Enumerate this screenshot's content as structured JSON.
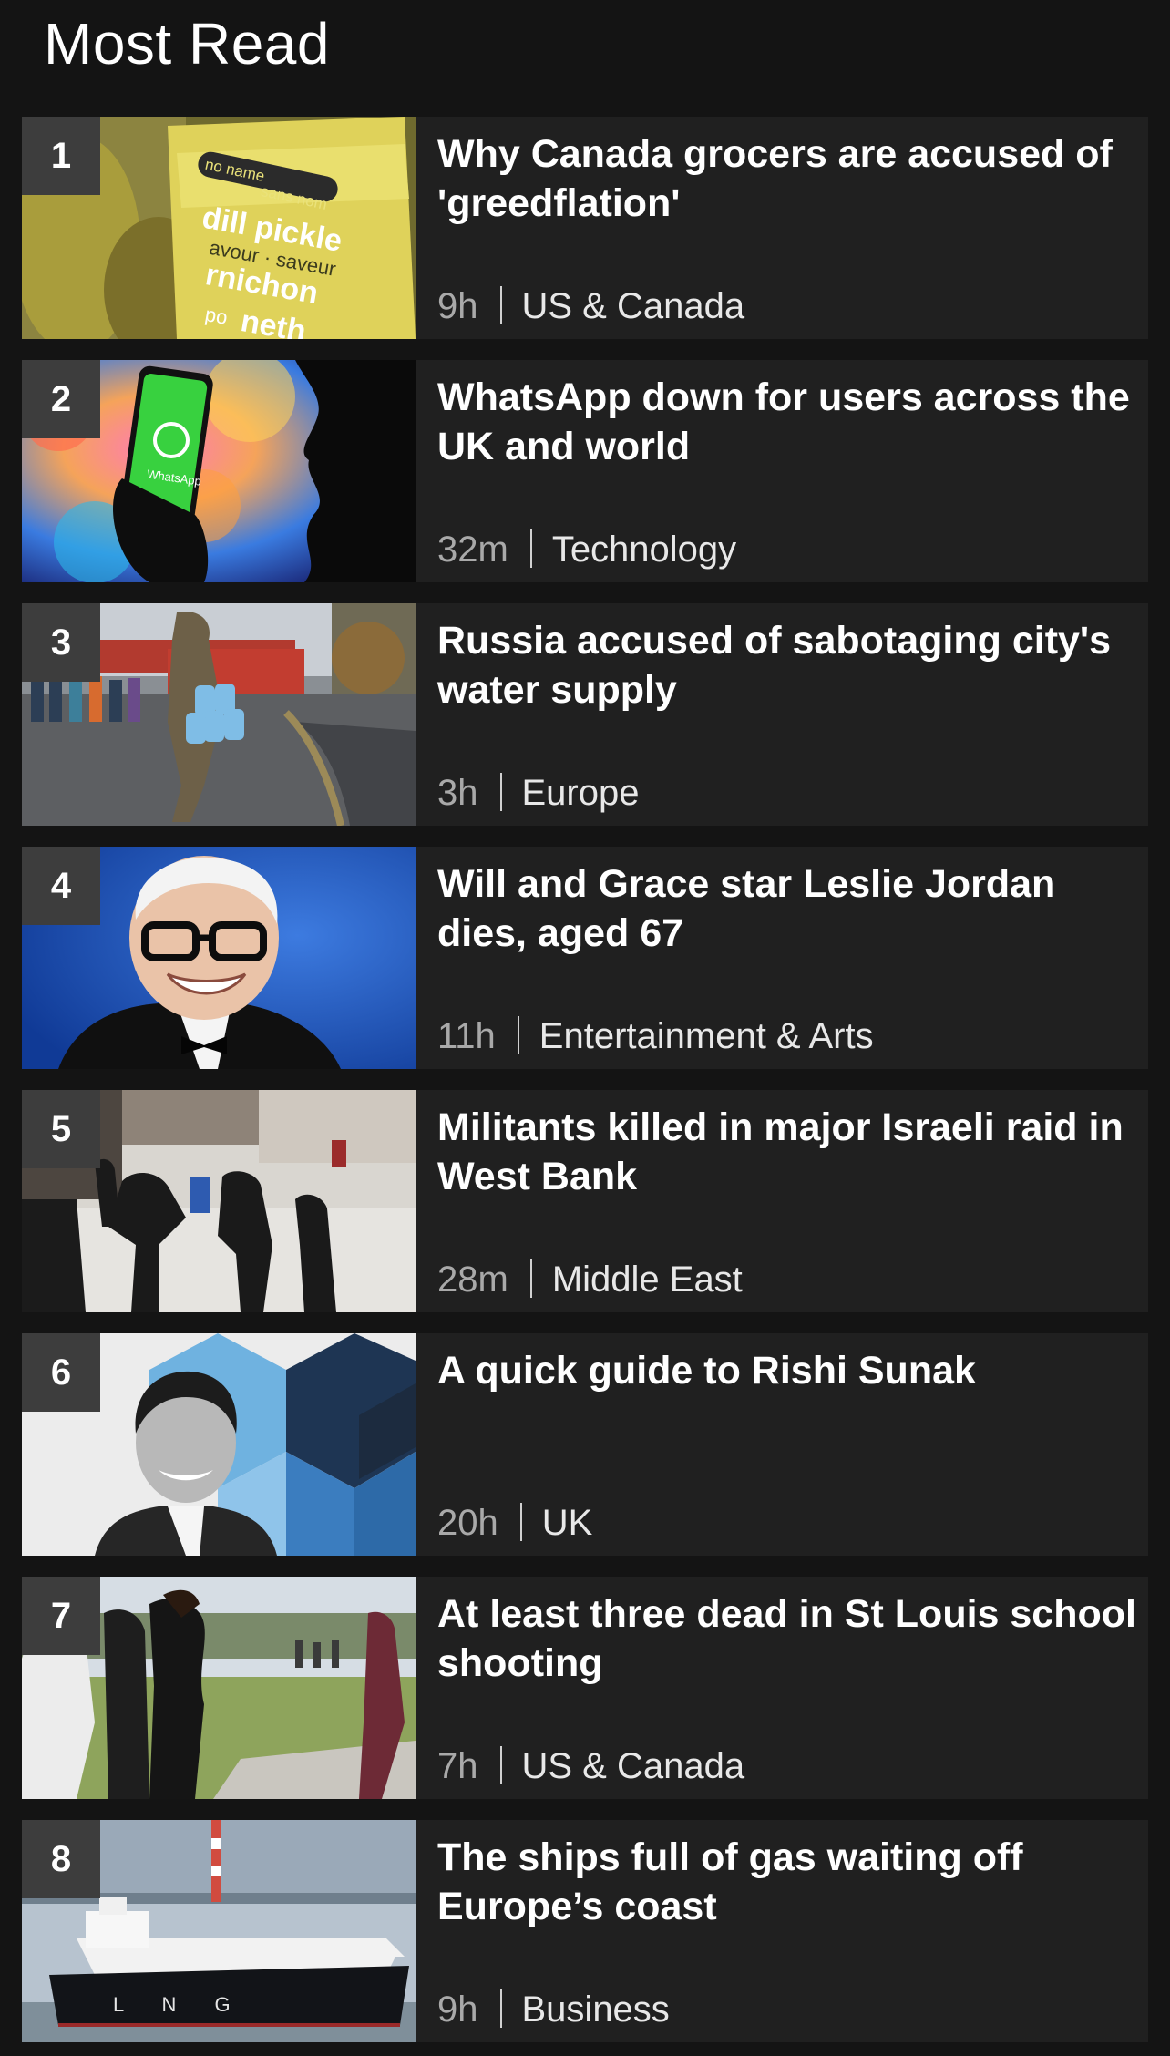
{
  "section": {
    "title": "Most Read"
  },
  "articles": [
    {
      "rank": "1",
      "headline": "Why Canada grocers are accused of 'greedflation'",
      "age": "9h",
      "topic": "US & Canada",
      "image_label_1": "no name",
      "image_label_2": "sans nom",
      "image_label_3": "dill pickle",
      "image_label_4": "avour · saveur",
      "image_label_5": "rnichon",
      "image_label_6": "po",
      "image_label_7": "neth"
    },
    {
      "rank": "2",
      "headline": "WhatsApp down for users across the UK and world",
      "age": "32m",
      "topic": "Technology",
      "image_label_1": "WhatsApp"
    },
    {
      "rank": "3",
      "headline": "Russia accused of sabotaging city's water supply",
      "age": "3h",
      "topic": "Europe"
    },
    {
      "rank": "4",
      "headline": "Will and Grace star Leslie Jordan dies, aged 67",
      "age": "11h",
      "topic": "Entertainment & Arts"
    },
    {
      "rank": "5",
      "headline": "Militants killed in major Israeli raid in West Bank",
      "age": "28m",
      "topic": "Middle East"
    },
    {
      "rank": "6",
      "headline": "A quick guide to Rishi Sunak",
      "age": "20h",
      "topic": "UK"
    },
    {
      "rank": "7",
      "headline": "At least three dead in St Louis school shooting",
      "age": "7h",
      "topic": "US & Canada"
    },
    {
      "rank": "8",
      "headline": "The ships full of gas waiting off Europe’s coast",
      "age": "9h",
      "topic": "Business",
      "image_label_1": "L   N   G"
    }
  ]
}
